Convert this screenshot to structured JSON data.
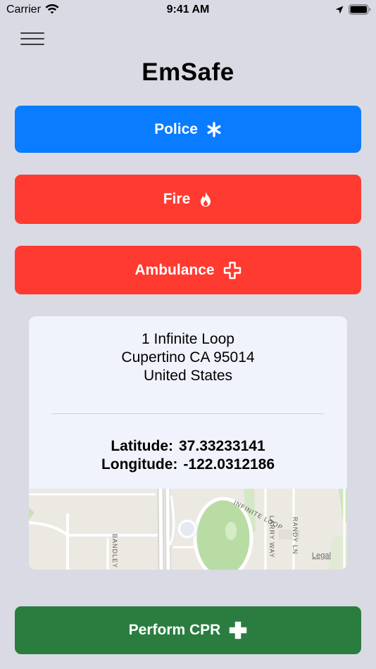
{
  "status_bar": {
    "carrier": "Carrier",
    "time": "9:41 AM",
    "icons": [
      "wifi-icon",
      "location-arrow-icon",
      "battery-icon"
    ]
  },
  "header": {
    "menu_icon": "hamburger-menu-icon",
    "title": "EmSafe"
  },
  "buttons": {
    "police": {
      "label": "Police",
      "icon": "asterisk-icon",
      "color": "#0a7cff"
    },
    "fire": {
      "label": "Fire",
      "icon": "flame-icon",
      "color": "#ff3a30"
    },
    "ambulance": {
      "label": "Ambulance",
      "icon": "medical-cross-outline-icon",
      "color": "#ff3a30"
    },
    "cpr": {
      "label": "Perform CPR",
      "icon": "medical-cross-filled-icon",
      "color": "#2a7d3f"
    }
  },
  "location": {
    "address_line1": "1 Infinite Loop",
    "address_line2": "Cupertino CA 95014",
    "address_line3": "United States",
    "latitude_label": "Latitude:",
    "latitude_value": "37.33233141",
    "longitude_label": "Longitude:",
    "longitude_value": "-122.0312186"
  },
  "map": {
    "street_labels": [
      "INFINITE LOOP",
      "BANDLEY",
      "LARRY WAY",
      "RANDY LN"
    ],
    "legal_label": "Legal"
  }
}
